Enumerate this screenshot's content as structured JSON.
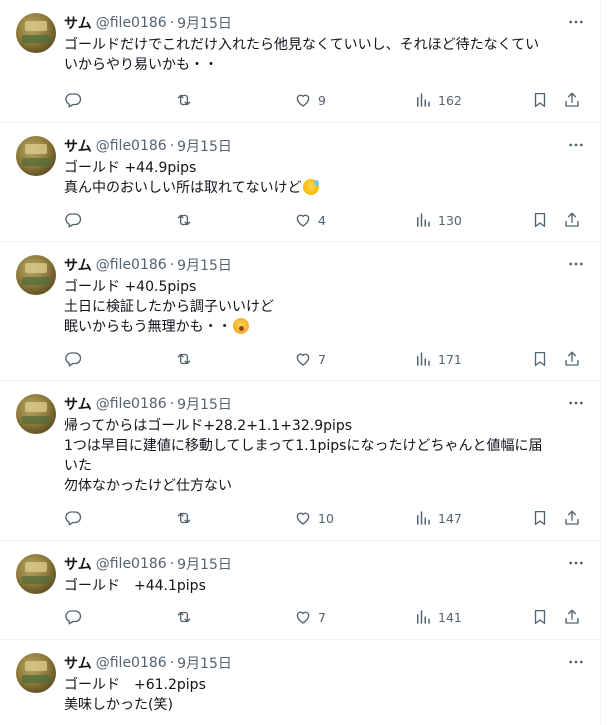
{
  "tweets": [
    {
      "name": "サム",
      "handle": "@file0186",
      "date": "9月15日",
      "lines": [
        "ゴールドだけでこれだけ入れたら他見なくていいし、それほど待たなくてい",
        "いからやり易いかも・・"
      ],
      "likes": "9",
      "views": "162"
    },
    {
      "name": "サム",
      "handle": "@file0186",
      "date": "9月15日",
      "lines": [
        "ゴールド +44.9pips",
        "真ん中のおいしい所は取れてないけど"
      ],
      "emoji": "grinning-sweat-emoji",
      "likes": "4",
      "views": "130"
    },
    {
      "name": "サム",
      "handle": "@file0186",
      "date": "9月15日",
      "lines": [
        "ゴールド +40.5pips",
        "土日に検証したから調子いいけど",
        "眠いからもう無理かも・・"
      ],
      "emoji": "yawning-face-emoji",
      "likes": "7",
      "views": "171"
    },
    {
      "name": "サム",
      "handle": "@file0186",
      "date": "9月15日",
      "lines": [
        "帰ってからはゴールド+28.2+1.1+32.9pips",
        "1つは早目に建値に移動してしまって1.1pipsになったけどちゃんと値幅に届",
        "いた",
        "勿体なかったけど仕方ない"
      ],
      "likes": "10",
      "views": "147"
    },
    {
      "name": "サム",
      "handle": "@file0186",
      "date": "9月15日",
      "lines": [
        "ゴールド　+44.1pips"
      ],
      "likes": "7",
      "views": "141"
    },
    {
      "name": "サム",
      "handle": "@file0186",
      "date": "9月15日",
      "lines": [
        "ゴールド　+61.2pips",
        "美味しかった(笑)"
      ],
      "likes": "",
      "views": ""
    }
  ],
  "separator": "·"
}
